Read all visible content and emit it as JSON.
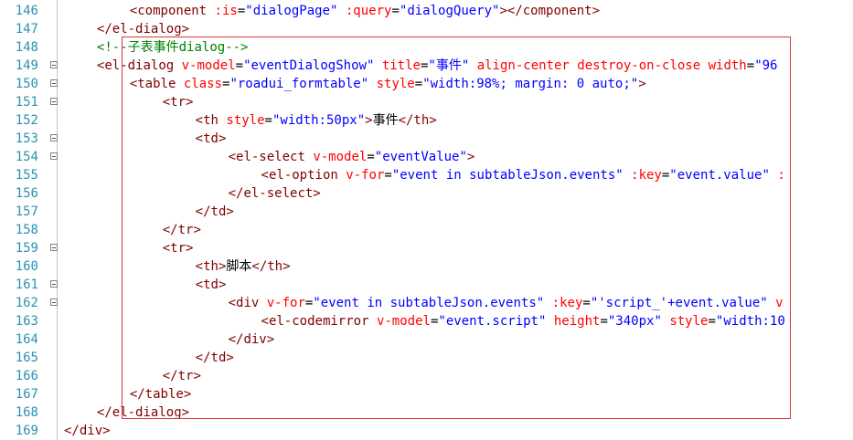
{
  "lines": [
    {
      "n": "146",
      "indent": 3,
      "fold": false,
      "tokens": [
        [
          "t",
          "<component "
        ],
        [
          "a",
          ":is"
        ],
        [
          "p",
          "="
        ],
        [
          "v",
          "\"dialogPage\""
        ],
        [
          "p",
          " "
        ],
        [
          "a",
          ":query"
        ],
        [
          "p",
          "="
        ],
        [
          "v",
          "\"dialogQuery\""
        ],
        [
          "t",
          "></component>"
        ]
      ]
    },
    {
      "n": "147",
      "indent": 2,
      "fold": false,
      "tokens": [
        [
          "t",
          "</el-dialog>"
        ]
      ]
    },
    {
      "n": "148",
      "indent": 2,
      "fold": false,
      "tokens": [
        [
          "c",
          "<!--子表事件dialog-->"
        ]
      ]
    },
    {
      "n": "149",
      "indent": 2,
      "fold": true,
      "tokens": [
        [
          "t",
          "<el-dialog "
        ],
        [
          "a",
          "v-model"
        ],
        [
          "p",
          "="
        ],
        [
          "v",
          "\"eventDialogShow\""
        ],
        [
          "p",
          " "
        ],
        [
          "a",
          "title"
        ],
        [
          "p",
          "="
        ],
        [
          "v",
          "\"事件\""
        ],
        [
          "p",
          " "
        ],
        [
          "a",
          "align-center"
        ],
        [
          "p",
          " "
        ],
        [
          "a",
          "destroy-on-close"
        ],
        [
          "p",
          " "
        ],
        [
          "a",
          "width"
        ],
        [
          "p",
          "="
        ],
        [
          "v",
          "\"96"
        ]
      ]
    },
    {
      "n": "150",
      "indent": 3,
      "fold": true,
      "tokens": [
        [
          "t",
          "<table "
        ],
        [
          "a",
          "class"
        ],
        [
          "p",
          "="
        ],
        [
          "v",
          "\"roadui_formtable\""
        ],
        [
          "p",
          " "
        ],
        [
          "a",
          "style"
        ],
        [
          "p",
          "="
        ],
        [
          "v",
          "\"width:98%; margin: 0 auto;\""
        ],
        [
          "t",
          ">"
        ]
      ]
    },
    {
      "n": "151",
      "indent": 4,
      "fold": true,
      "tokens": [
        [
          "t",
          "<tr>"
        ]
      ]
    },
    {
      "n": "152",
      "indent": 5,
      "fold": false,
      "tokens": [
        [
          "t",
          "<th "
        ],
        [
          "a",
          "style"
        ],
        [
          "p",
          "="
        ],
        [
          "v",
          "\"width:50px\""
        ],
        [
          "t",
          ">"
        ],
        [
          "p",
          "事件"
        ],
        [
          "t",
          "</th>"
        ]
      ]
    },
    {
      "n": "153",
      "indent": 5,
      "fold": true,
      "tokens": [
        [
          "t",
          "<td>"
        ]
      ]
    },
    {
      "n": "154",
      "indent": 6,
      "fold": true,
      "tokens": [
        [
          "t",
          "<el-select "
        ],
        [
          "a",
          "v-model"
        ],
        [
          "p",
          "="
        ],
        [
          "v",
          "\"eventValue\""
        ],
        [
          "t",
          ">"
        ]
      ]
    },
    {
      "n": "155",
      "indent": 7,
      "fold": false,
      "tokens": [
        [
          "t",
          "<el-option "
        ],
        [
          "a",
          "v-for"
        ],
        [
          "p",
          "="
        ],
        [
          "v",
          "\"event in subtableJson.events\""
        ],
        [
          "p",
          " "
        ],
        [
          "a",
          ":key"
        ],
        [
          "p",
          "="
        ],
        [
          "v",
          "\"event.value\""
        ],
        [
          "p",
          " "
        ],
        [
          "a",
          ":"
        ]
      ]
    },
    {
      "n": "156",
      "indent": 6,
      "fold": false,
      "tokens": [
        [
          "t",
          "</el-select>"
        ]
      ]
    },
    {
      "n": "157",
      "indent": 5,
      "fold": false,
      "tokens": [
        [
          "t",
          "</td>"
        ]
      ]
    },
    {
      "n": "158",
      "indent": 4,
      "fold": false,
      "tokens": [
        [
          "t",
          "</tr>"
        ]
      ]
    },
    {
      "n": "159",
      "indent": 4,
      "fold": true,
      "tokens": [
        [
          "t",
          "<tr>"
        ]
      ]
    },
    {
      "n": "160",
      "indent": 5,
      "fold": false,
      "tokens": [
        [
          "t",
          "<th>"
        ],
        [
          "p",
          "脚本"
        ],
        [
          "t",
          "</th>"
        ]
      ]
    },
    {
      "n": "161",
      "indent": 5,
      "fold": true,
      "tokens": [
        [
          "t",
          "<td>"
        ]
      ]
    },
    {
      "n": "162",
      "indent": 6,
      "fold": true,
      "tokens": [
        [
          "t",
          "<div "
        ],
        [
          "a",
          "v-for"
        ],
        [
          "p",
          "="
        ],
        [
          "v",
          "\"event in subtableJson.events\""
        ],
        [
          "p",
          " "
        ],
        [
          "a",
          ":key"
        ],
        [
          "p",
          "="
        ],
        [
          "v",
          "\"'script_'+event.value\""
        ],
        [
          "p",
          " "
        ],
        [
          "a",
          "v"
        ]
      ]
    },
    {
      "n": "163",
      "indent": 7,
      "fold": false,
      "tokens": [
        [
          "t",
          "<el-codemirror "
        ],
        [
          "a",
          "v-model"
        ],
        [
          "p",
          "="
        ],
        [
          "v",
          "\"event.script\""
        ],
        [
          "p",
          " "
        ],
        [
          "a",
          "height"
        ],
        [
          "p",
          "="
        ],
        [
          "v",
          "\"340px\""
        ],
        [
          "p",
          " "
        ],
        [
          "a",
          "style"
        ],
        [
          "p",
          "="
        ],
        [
          "v",
          "\"width:10"
        ]
      ]
    },
    {
      "n": "164",
      "indent": 6,
      "fold": false,
      "tokens": [
        [
          "t",
          "</div>"
        ]
      ]
    },
    {
      "n": "165",
      "indent": 5,
      "fold": false,
      "tokens": [
        [
          "t",
          "</td>"
        ]
      ]
    },
    {
      "n": "166",
      "indent": 4,
      "fold": false,
      "tokens": [
        [
          "t",
          "</tr>"
        ]
      ]
    },
    {
      "n": "167",
      "indent": 3,
      "fold": false,
      "tokens": [
        [
          "t",
          "</table>"
        ]
      ]
    },
    {
      "n": "168",
      "indent": 2,
      "fold": false,
      "tokens": [
        [
          "t",
          "</el-dialog>"
        ]
      ]
    },
    {
      "n": "169",
      "indent": 1,
      "fold": false,
      "tokens": [
        [
          "t",
          "</div>"
        ]
      ]
    }
  ]
}
